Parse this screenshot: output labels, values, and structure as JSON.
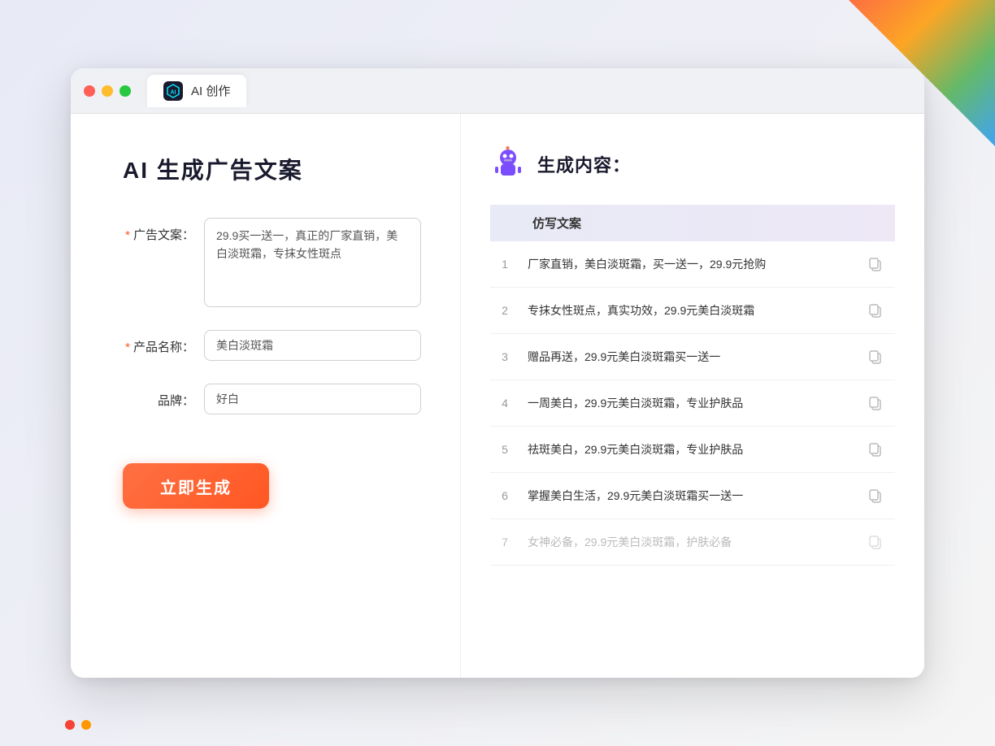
{
  "window": {
    "tab_icon_label": "AI",
    "tab_title": "AI 创作"
  },
  "left": {
    "page_title": "AI 生成广告文案",
    "fields": [
      {
        "id": "ad_copy",
        "label": "广告文案：",
        "required": true,
        "type": "textarea",
        "value": "29.9买一送一，真正的厂家直销，美白淡斑霜，专抹女性斑点"
      },
      {
        "id": "product_name",
        "label": "产品名称：",
        "required": true,
        "type": "input",
        "value": "美白淡斑霜"
      },
      {
        "id": "brand",
        "label": "品牌：",
        "required": false,
        "type": "input",
        "value": "好白"
      }
    ],
    "generate_button_label": "立即生成"
  },
  "right": {
    "title": "生成内容：",
    "table_header": "仿写文案",
    "results": [
      {
        "id": 1,
        "text": "厂家直销，美白淡斑霜，买一送一，29.9元抢购",
        "faded": false
      },
      {
        "id": 2,
        "text": "专抹女性斑点，真实功效，29.9元美白淡斑霜",
        "faded": false
      },
      {
        "id": 3,
        "text": "赠品再送，29.9元美白淡斑霜买一送一",
        "faded": false
      },
      {
        "id": 4,
        "text": "一周美白，29.9元美白淡斑霜，专业护肤品",
        "faded": false
      },
      {
        "id": 5,
        "text": "祛斑美白，29.9元美白淡斑霜，专业护肤品",
        "faded": false
      },
      {
        "id": 6,
        "text": "掌握美白生活，29.9元美白淡斑霜买一送一",
        "faded": false
      },
      {
        "id": 7,
        "text": "女神必备，29.9元美白淡斑霜，护肤必备",
        "faded": true
      }
    ]
  },
  "colors": {
    "accent": "#ff5722",
    "accent_gradient_start": "#ff7043",
    "accent_gradient_end": "#ff5722"
  }
}
